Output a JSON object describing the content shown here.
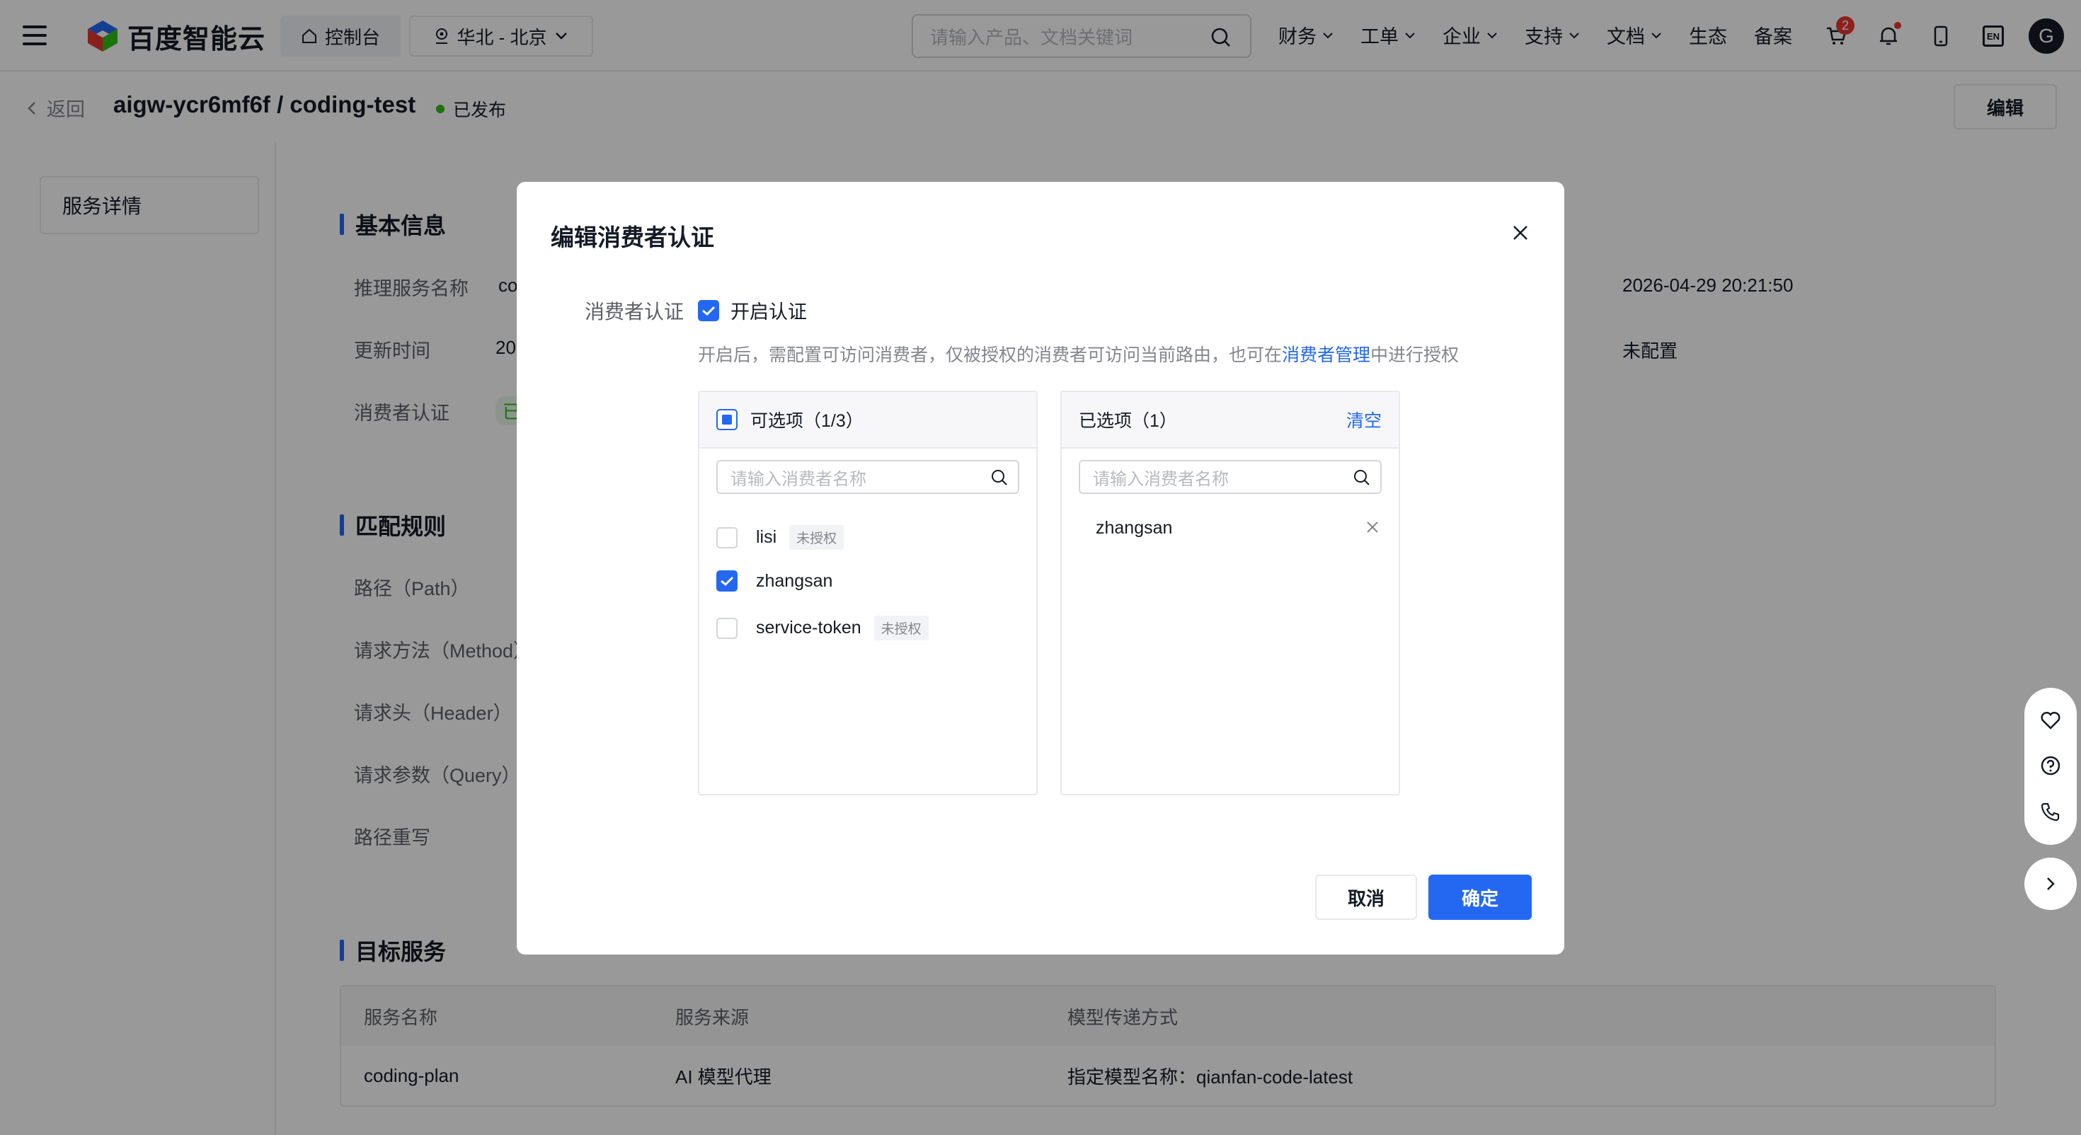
{
  "topbar": {
    "brand": "百度智能云",
    "console": "控制台",
    "region": "华北 - 北京",
    "search_placeholder": "请输入产品、文档关键词",
    "nav": [
      "财务",
      "工单",
      "企业",
      "支持",
      "文档",
      "生态",
      "备案"
    ],
    "cart_count": "2",
    "lang": "EN",
    "avatar_initial": "G"
  },
  "subhead": {
    "back": "返回",
    "title": "aigw-ycr6mf6f / coding-test",
    "status": "已发布",
    "edit": "编辑"
  },
  "sidebar": {
    "items": [
      "服务详情"
    ]
  },
  "basic_info": {
    "title": "基本信息",
    "rows": [
      {
        "label": "推理服务名称",
        "value": "co"
      },
      {
        "label": "更新时间",
        "value": "20"
      },
      {
        "label": "消费者认证",
        "value": "已"
      }
    ],
    "right_values": [
      "2026-04-29 20:21:50",
      "未配置"
    ]
  },
  "match_rules": {
    "title": "匹配规则",
    "rows": [
      "路径（Path）",
      "请求方法（Method）",
      "请求头（Header）",
      "请求参数（Query）",
      "路径重写"
    ]
  },
  "target_service": {
    "title": "目标服务",
    "columns": [
      "服务名称",
      "服务来源",
      "模型传递方式"
    ],
    "rows": [
      [
        "coding-plan",
        "AI 模型代理",
        "指定模型名称：qianfan-code-latest"
      ]
    ]
  },
  "modal": {
    "title": "编辑消费者认证",
    "auth_label": "消费者认证",
    "auth_checkbox": "开启认证",
    "hint_before": "开启后，需配置可访问消费者，仅被授权的消费者可访问当前路由，也可在",
    "hint_link": "消费者管理",
    "hint_after": "中进行授权",
    "left_pane": {
      "header": "可选项（1/3）",
      "search_placeholder": "请输入消费者名称",
      "options": [
        {
          "name": "lisi",
          "tag": "未授权",
          "checked": false
        },
        {
          "name": "zhangsan",
          "tag": "",
          "checked": true
        },
        {
          "name": "service-token",
          "tag": "未授权",
          "checked": false
        }
      ]
    },
    "right_pane": {
      "header": "已选项（1）",
      "clear": "清空",
      "search_placeholder": "请输入消费者名称",
      "selected": [
        "zhangsan"
      ]
    },
    "cancel": "取消",
    "ok": "确定"
  },
  "colors": {
    "primary": "#2468f2",
    "success": "#30bf13",
    "badge": "#e8372f"
  }
}
